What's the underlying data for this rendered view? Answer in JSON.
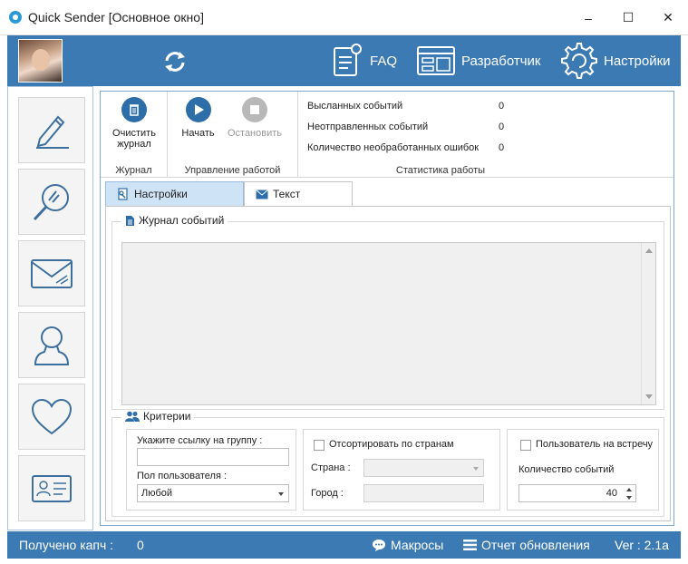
{
  "window": {
    "title": "Quick Sender [Основное окно]",
    "minimize": "–",
    "maximize": "☐",
    "close": "✕"
  },
  "header": {
    "faq": "FAQ",
    "developer": "Разработчик",
    "settings": "Настройки"
  },
  "ribbon": {
    "clear_log": "Очистить журнал",
    "group_log": "Журнал",
    "start": "Начать",
    "stop": "Остановить",
    "group_control": "Управление работой",
    "stats": [
      {
        "label": "Высланных событий",
        "value": "0"
      },
      {
        "label": "Неотправленных  событий",
        "value": "0"
      },
      {
        "label": "Количество необработанных ошибок",
        "value": "0"
      }
    ],
    "group_stats": "Статистика работы"
  },
  "tabs": {
    "settings": "Настройки",
    "text": "Текст"
  },
  "log": {
    "title": "Журнал событий"
  },
  "criteria": {
    "title": "Критерии",
    "group_link_label": "Укажите ссылку на группу :",
    "group_link_value": "",
    "gender_label": "Пол пользователя :",
    "gender_value": "Любой",
    "sort_by_country": "Отсортировать по странам",
    "country_label": "Страна :",
    "city_label": "Город :",
    "user_at_meeting": "Пользователь на встречу",
    "events_count_label": "Количество событий",
    "events_count_value": "40"
  },
  "status": {
    "captcha_label": "Получено капч :",
    "captcha_value": "0",
    "macros": "Макросы",
    "update_report": "Отчет обновления",
    "version": "Ver : 2.1a"
  },
  "colors": {
    "accent": "#3c7ab4",
    "icon": "#3d6f9e"
  }
}
